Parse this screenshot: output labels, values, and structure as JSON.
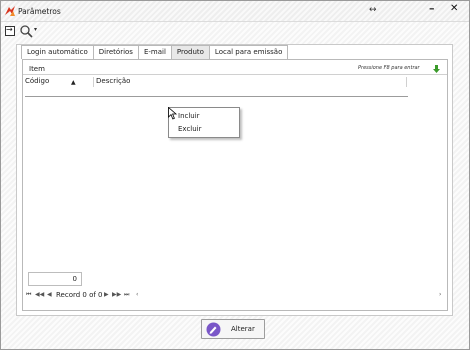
{
  "window": {
    "title": "Parâmetros",
    "restore_glyph": "↔",
    "minimize_glyph": "–",
    "close_glyph": "✕"
  },
  "toolbar": {
    "dropdown_glyph": "▾",
    "icons": [
      "exit-icon",
      "zoom-icon",
      "chevron-down-icon"
    ]
  },
  "tabs": [
    {
      "label": "Login automático"
    },
    {
      "label": "Diretórios"
    },
    {
      "label": "E-mail"
    },
    {
      "label": "Produto"
    },
    {
      "label": "Local para emissão"
    }
  ],
  "active_tab": "Produto",
  "grid": {
    "group_label": "Item",
    "hint": "Pressione F8 para entrar",
    "columns": [
      "Código",
      "Descrição"
    ],
    "sort_glyph": "▲",
    "count": "0",
    "navigation": {
      "first": "⏮",
      "prev_page": "◀◀",
      "prev": "◀",
      "record": "Record 0 of 0",
      "next": "▶",
      "next_page": "▶▶",
      "last": "⏭",
      "extra": "‹",
      "right": "›"
    }
  },
  "context_menu": {
    "items": [
      {
        "label": "Incluir"
      },
      {
        "label": "Excluir"
      }
    ]
  },
  "footer": {
    "alterar_label": "Alterar"
  },
  "colors": {
    "app_icon_red": "#d9351f",
    "add_green": "#3a9a2a",
    "alterar_purple": "#7a57c8"
  }
}
